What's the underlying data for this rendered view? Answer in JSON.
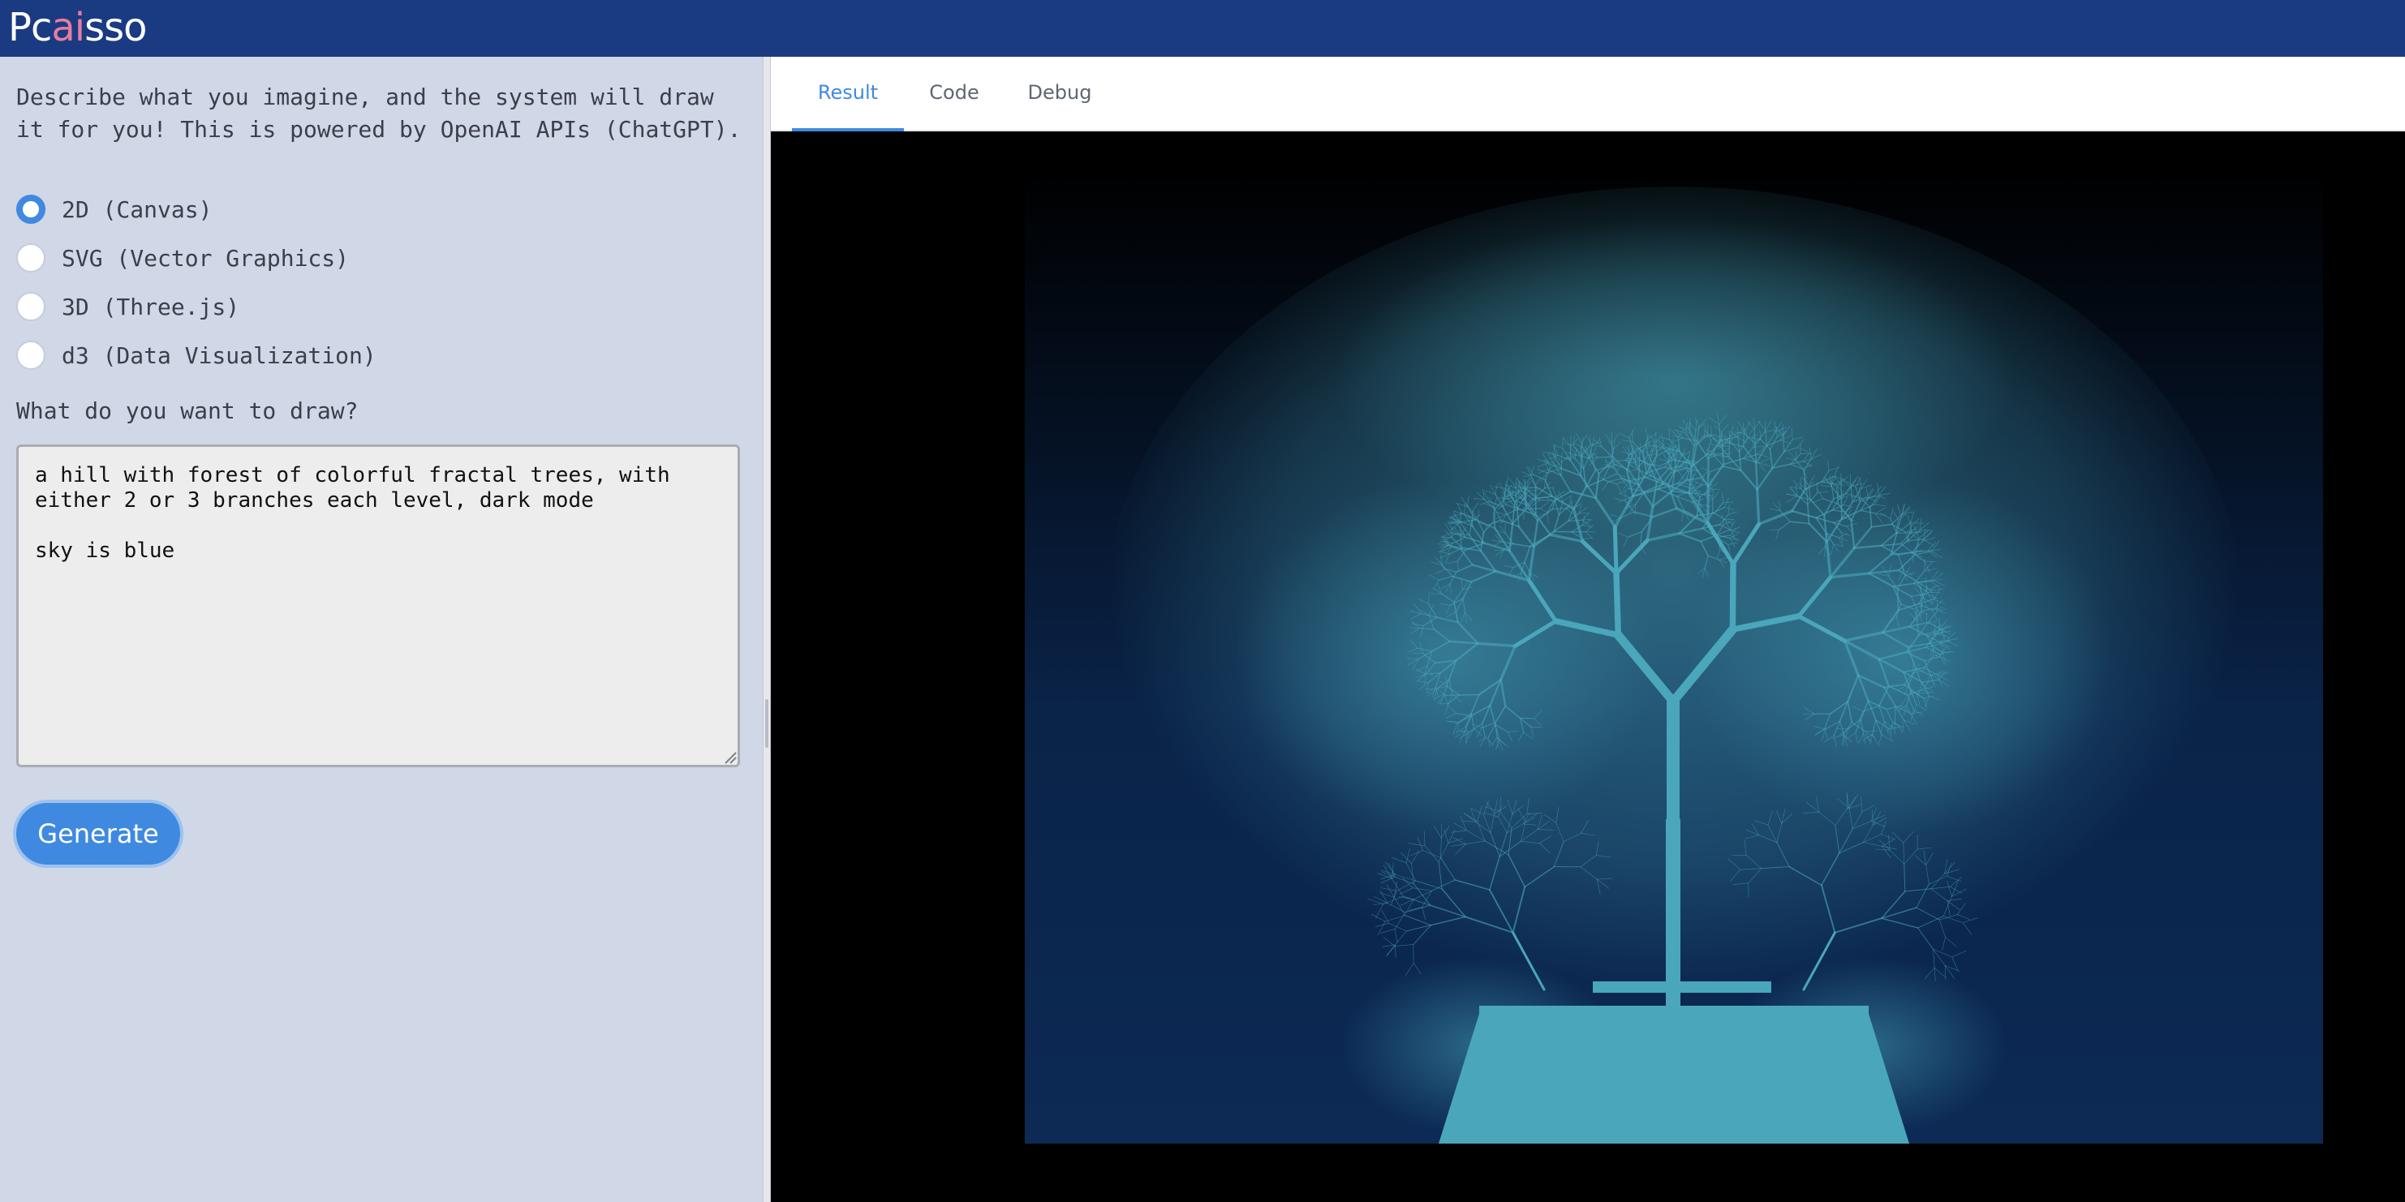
{
  "app": {
    "logo_prefix": "Pc",
    "logo_ai": "ai",
    "logo_suffix": "sso"
  },
  "left": {
    "description": "Describe what you imagine, and the system will draw it for you! This is powered by OpenAI APIs (ChatGPT).",
    "modes": [
      {
        "label": "2D (Canvas)",
        "checked": true
      },
      {
        "label": "SVG (Vector Graphics)",
        "checked": false
      },
      {
        "label": "3D (Three.js)",
        "checked": false
      },
      {
        "label": "d3 (Data Visualization)",
        "checked": false
      }
    ],
    "prompt_label": "What do you want to draw?",
    "prompt_value": "a hill with forest of colorful fractal trees, with\neither 2 or 3 branches each level, dark mode\n\nsky is blue",
    "generate_label": "Generate"
  },
  "tabs": [
    {
      "label": "Result",
      "active": true
    },
    {
      "label": "Code",
      "active": false
    },
    {
      "label": "Debug",
      "active": false
    }
  ],
  "colors": {
    "topbar": "#1a3a82",
    "accent": "#3f8ae0",
    "logo_ai": "#e77ca0",
    "panel_bg": "#d0d7e7",
    "sky_top": "#000000",
    "sky_bottom": "#0c2a55",
    "tree": "#4aa6bb"
  }
}
